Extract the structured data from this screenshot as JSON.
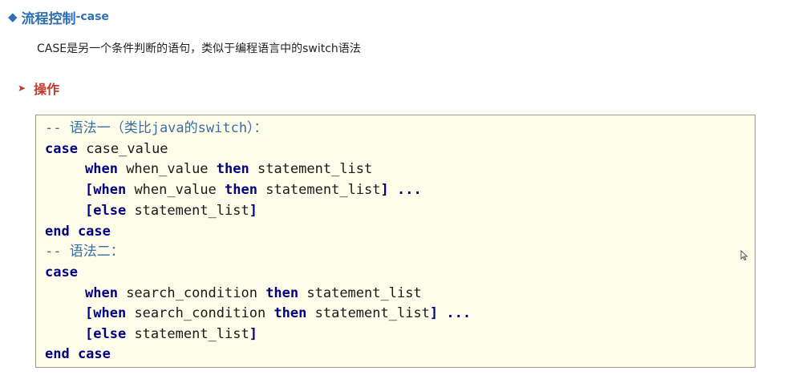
{
  "title": {
    "diamond": "◆",
    "main": "流程控制",
    "sub": "-case"
  },
  "description": "CASE是另一个条件判断的语句，类似于编程语言中的switch语法",
  "operation": {
    "arrow": "➤",
    "label": "操作"
  },
  "code": {
    "comment1": "-- 语法一（类比java的switch）：",
    "line2": {
      "kw": "case",
      "rest": " case_value"
    },
    "line3": {
      "kw1": "when",
      "mid": " when_value ",
      "kw2": "then",
      "rest": " statement_list"
    },
    "line4": {
      "b1": "[",
      "kw1": "when",
      "mid": " when_value ",
      "kw2": "then",
      "rest": " statement_list",
      "b2": "] ..."
    },
    "line5": {
      "b1": "[",
      "kw": "else",
      "rest": " statement_list",
      "b2": "]"
    },
    "line6": {
      "kw": "end case"
    },
    "comment2": "-- 语法二：",
    "line8": {
      "kw": "case"
    },
    "line9": {
      "kw1": "when",
      "mid": " search_condition ",
      "kw2": "then",
      "rest": " statement_list"
    },
    "line10": {
      "b1": "[",
      "kw1": "when",
      "mid": " search_condition ",
      "kw2": "then",
      "rest": " statement_list",
      "b2": "] ..."
    },
    "line11": {
      "b1": "[",
      "kw": "else",
      "rest": " statement_list",
      "b2": "]"
    },
    "line12": {
      "kw": "end case"
    }
  },
  "cursor_icon": "mouse-pointer-icon"
}
